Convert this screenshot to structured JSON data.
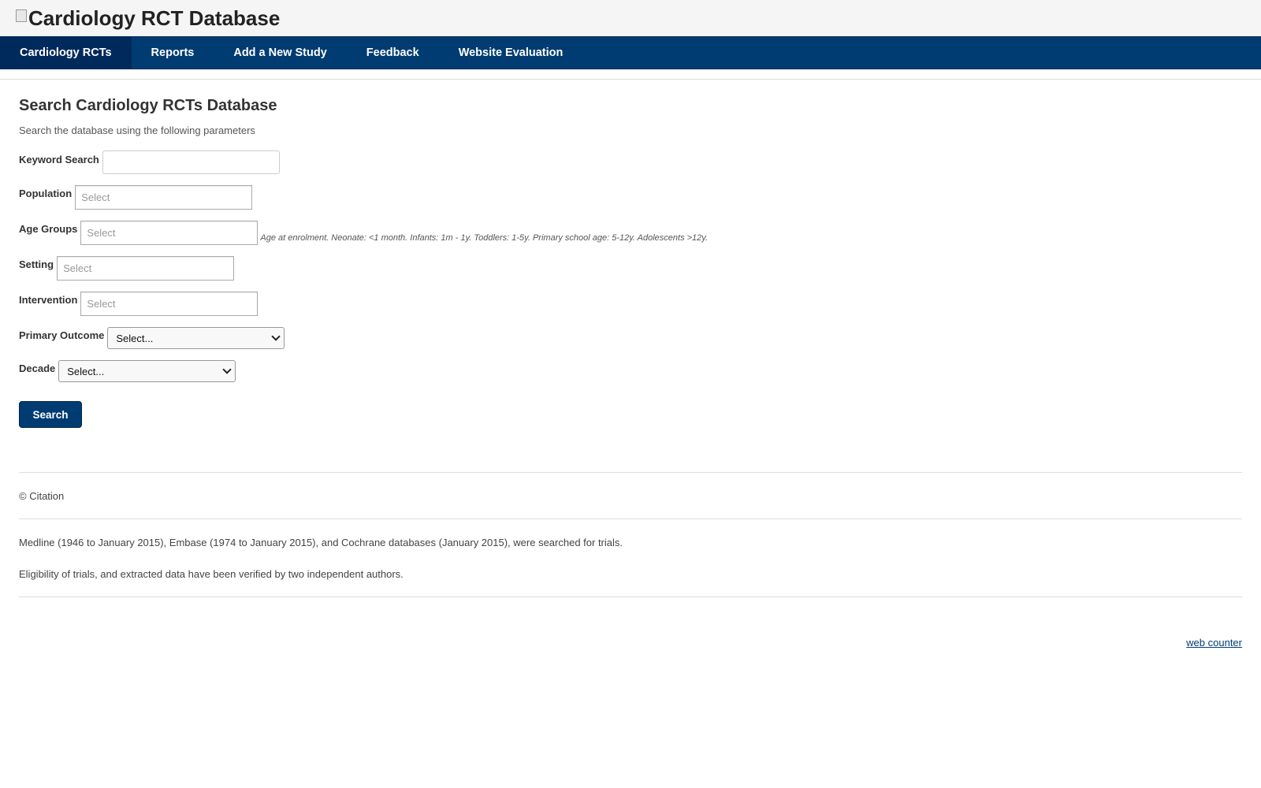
{
  "header": {
    "logo_text": "Cardiology RCT Database"
  },
  "nav": {
    "items": [
      {
        "label": "Cardiology RCTs"
      },
      {
        "label": "Reports"
      },
      {
        "label": "Add a New Study"
      },
      {
        "label": "Feedback"
      },
      {
        "label": "Website Evaluation"
      }
    ]
  },
  "main": {
    "title": "Search Cardiology RCTs Database",
    "subtitle": "Search the database using the following parameters",
    "keyword_label": "Keyword Search",
    "keyword_value": "",
    "population_label": "Population",
    "population_placeholder": "Select",
    "age_label": "Age Groups",
    "age_placeholder": "Select",
    "age_hint": "Age at enrolment. Neonate: <1 month. Infants: 1m - 1y. Toddlers: 1-5y. Primary school age: 5-12y. Adolescents >12y.",
    "setting_label": "Setting",
    "setting_placeholder": "Select",
    "intervention_label": "Intervention",
    "intervention_placeholder": "Select",
    "outcome_label": "Primary Outcome",
    "outcome_value": "Select...",
    "decade_label": "Decade",
    "decade_value": "Select...",
    "search_button": "Search"
  },
  "footer": {
    "citation": "© Citation",
    "note1": "Medline (1946 to January 2015), Embase (1974 to January 2015), and Cochrane databases (January 2015), were searched for trials.",
    "note2": "Eligibility of trials, and extracted data have been verified by two independent authors.",
    "counter_link": "web counter"
  },
  "colors": {
    "nav_bg": "#003c71",
    "nav_active": "#002a5c",
    "header_bg": "#f5f5f5"
  }
}
